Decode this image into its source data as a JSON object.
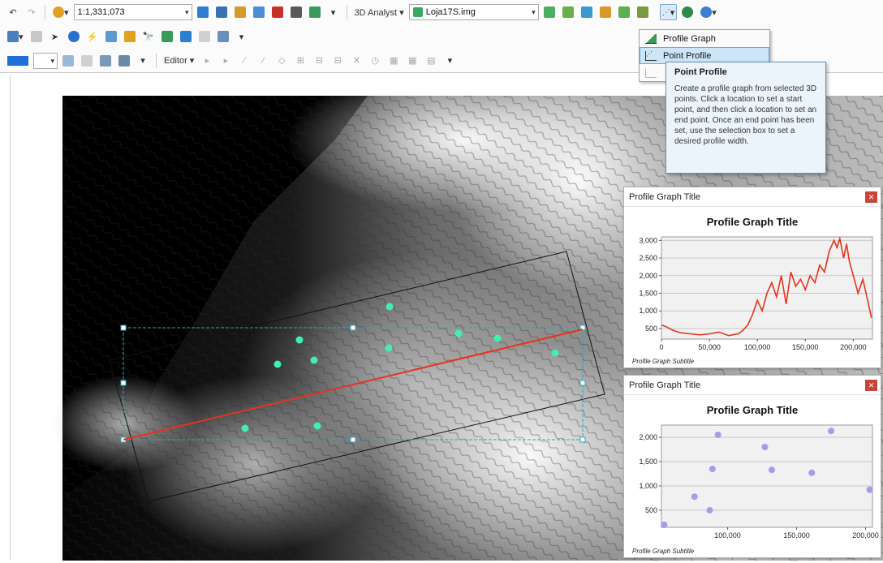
{
  "toolbar": {
    "scale": "1:1,331,073",
    "analyst_label": "3D Analyst ▾",
    "layer": "Loja17S.img",
    "editor_label": "Editor ▾"
  },
  "menu": {
    "items": [
      {
        "label": "Profile Graph",
        "icon": "profile-graph-icon"
      },
      {
        "label": "Point Profile",
        "icon": "point-profile-icon"
      },
      {
        "label": "",
        "icon": "disabled-profile-icon"
      }
    ]
  },
  "tooltip": {
    "title": "Point Profile",
    "body": "Create a profile graph from selected 3D points. Click a location to set a start point, and then click a location to set an end point. Once an end point has been set, use the selection box to set a desired profile width."
  },
  "graphs": [
    {
      "window_title": "Profile Graph Title",
      "chart_data": {
        "type": "line",
        "title": "Profile Graph Title",
        "subtitle": "Profile Graph Subtitle",
        "x_ticks": [
          "0",
          "50,000",
          "100,000",
          "150,000",
          "200,000"
        ],
        "y_ticks": [
          "500",
          "1,000",
          "1,500",
          "2,000",
          "2,500",
          "3,000"
        ],
        "xlim": [
          0,
          220000
        ],
        "ylim": [
          200,
          3100
        ],
        "series": [
          {
            "color": "#e8321e",
            "x": [
              0,
              5000,
              12000,
              20000,
              30000,
              40000,
              50000,
              60000,
              70000,
              80000,
              85000,
              90000,
              95000,
              100000,
              105000,
              110000,
              115000,
              120000,
              125000,
              130000,
              135000,
              140000,
              145000,
              150000,
              155000,
              160000,
              165000,
              170000,
              175000,
              180000,
              183000,
              186000,
              190000,
              193000,
              196000,
              200000,
              205000,
              210000,
              215000,
              219000
            ],
            "y": [
              600,
              550,
              450,
              380,
              350,
              320,
              350,
              400,
              300,
              350,
              450,
              600,
              900,
              1300,
              1000,
              1500,
              1800,
              1400,
              2000,
              1200,
              2100,
              1700,
              1900,
              1600,
              2000,
              1800,
              2300,
              2100,
              2700,
              3000,
              2800,
              3050,
              2500,
              2900,
              2400,
              2000,
              1500,
              1900,
              1300,
              800
            ]
          }
        ]
      }
    },
    {
      "window_title": "Profile Graph Title",
      "chart_data": {
        "type": "scatter",
        "title": "Profile Graph Title",
        "subtitle": "Profile Graph Subtitle",
        "x_ticks": [
          "100,000",
          "150,000",
          "200,000"
        ],
        "y_ticks": [
          "500",
          "1,000",
          "1,500",
          "2,000"
        ],
        "xlim": [
          52000,
          205000
        ],
        "ylim": [
          150,
          2250
        ],
        "series": [
          {
            "color": "#a99be8",
            "x": [
              54000,
              76000,
              87000,
              89000,
              93000,
              127000,
              132000,
              161000,
              175000,
              203000
            ],
            "y": [
              200,
              780,
              500,
              1350,
              2050,
              1800,
              1330,
              1270,
              2130,
              920
            ]
          }
        ]
      }
    }
  ],
  "colors": {
    "profile_line": "#e8321e",
    "selection_box": "#2aa7b8",
    "points": "#3ff0b0"
  }
}
